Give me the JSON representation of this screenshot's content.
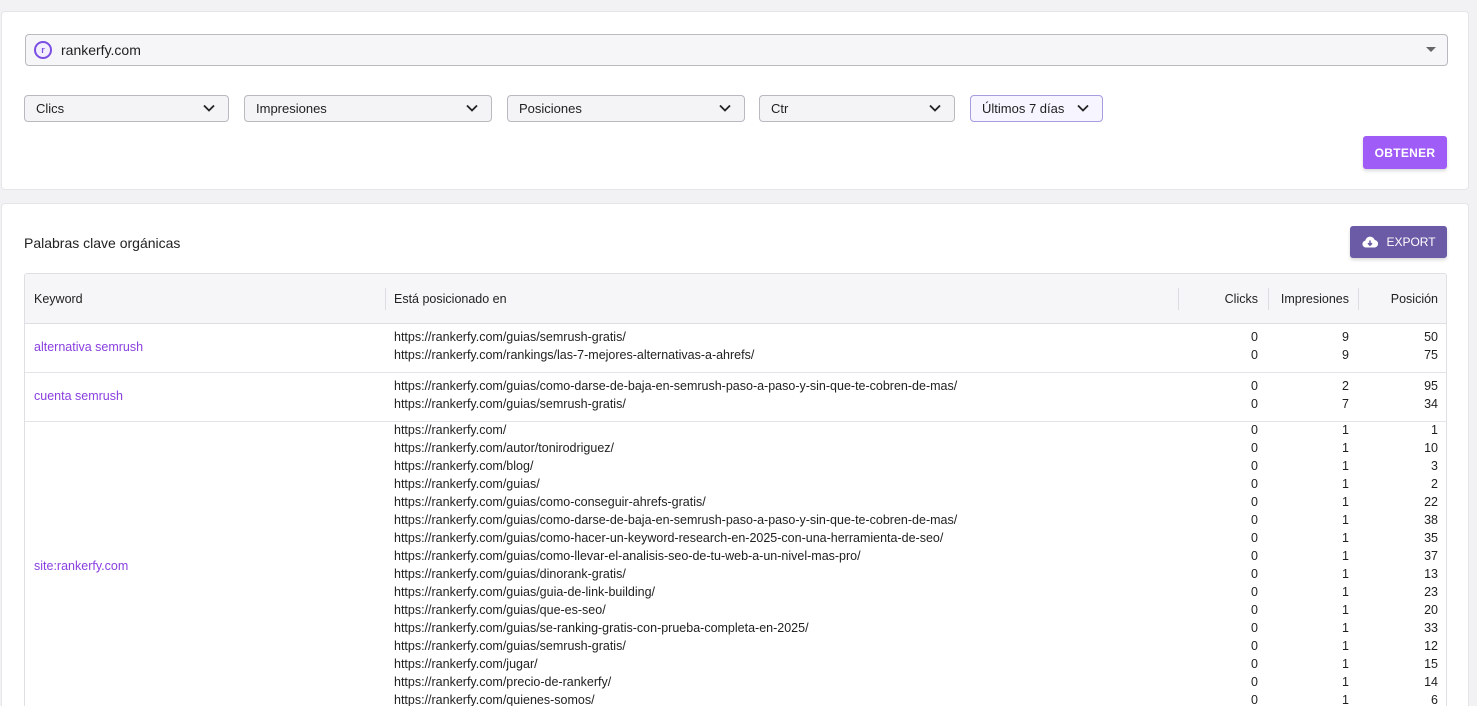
{
  "site": {
    "name": "rankerfy.com",
    "logo_text": "r"
  },
  "filters": [
    {
      "label": "Clics"
    },
    {
      "label": "Impresiones"
    },
    {
      "label": "Posiciones"
    },
    {
      "label": "Ctr"
    },
    {
      "label": "Últimos 7 días"
    }
  ],
  "obtener_label": "OBTENER",
  "section_title": "Palabras clave orgánicas",
  "export_label": "EXPORT",
  "table": {
    "headers": {
      "keyword": "Keyword",
      "url": "Está posicionado en",
      "clicks": "Clicks",
      "impresiones": "Impresiones",
      "posicion": "Posición"
    },
    "groups": [
      {
        "keyword": "alternativa semrush",
        "rows": [
          {
            "url": "https://rankerfy.com/guias/semrush-gratis/",
            "clicks": "0",
            "impresiones": "9",
            "posicion": "50"
          },
          {
            "url": "https://rankerfy.com/rankings/las-7-mejores-alternativas-a-ahrefs/",
            "clicks": "0",
            "impresiones": "9",
            "posicion": "75"
          }
        ]
      },
      {
        "keyword": "cuenta semrush",
        "rows": [
          {
            "url": "https://rankerfy.com/guias/como-darse-de-baja-en-semrush-paso-a-paso-y-sin-que-te-cobren-de-mas/",
            "clicks": "0",
            "impresiones": "2",
            "posicion": "95"
          },
          {
            "url": "https://rankerfy.com/guias/semrush-gratis/",
            "clicks": "0",
            "impresiones": "7",
            "posicion": "34"
          }
        ]
      },
      {
        "keyword": "site:rankerfy.com",
        "rows": [
          {
            "url": "https://rankerfy.com/",
            "clicks": "0",
            "impresiones": "1",
            "posicion": "1"
          },
          {
            "url": "https://rankerfy.com/autor/tonirodriguez/",
            "clicks": "0",
            "impresiones": "1",
            "posicion": "10"
          },
          {
            "url": "https://rankerfy.com/blog/",
            "clicks": "0",
            "impresiones": "1",
            "posicion": "3"
          },
          {
            "url": "https://rankerfy.com/guias/",
            "clicks": "0",
            "impresiones": "1",
            "posicion": "2"
          },
          {
            "url": "https://rankerfy.com/guias/como-conseguir-ahrefs-gratis/",
            "clicks": "0",
            "impresiones": "1",
            "posicion": "22"
          },
          {
            "url": "https://rankerfy.com/guias/como-darse-de-baja-en-semrush-paso-a-paso-y-sin-que-te-cobren-de-mas/",
            "clicks": "0",
            "impresiones": "1",
            "posicion": "38"
          },
          {
            "url": "https://rankerfy.com/guias/como-hacer-un-keyword-research-en-2025-con-una-herramienta-de-seo/",
            "clicks": "0",
            "impresiones": "1",
            "posicion": "35"
          },
          {
            "url": "https://rankerfy.com/guias/como-llevar-el-analisis-seo-de-tu-web-a-un-nivel-mas-pro/",
            "clicks": "0",
            "impresiones": "1",
            "posicion": "37"
          },
          {
            "url": "https://rankerfy.com/guias/dinorank-gratis/",
            "clicks": "0",
            "impresiones": "1",
            "posicion": "13"
          },
          {
            "url": "https://rankerfy.com/guias/guia-de-link-building/",
            "clicks": "0",
            "impresiones": "1",
            "posicion": "23"
          },
          {
            "url": "https://rankerfy.com/guias/que-es-seo/",
            "clicks": "0",
            "impresiones": "1",
            "posicion": "20"
          },
          {
            "url": "https://rankerfy.com/guias/se-ranking-gratis-con-prueba-completa-en-2025/",
            "clicks": "0",
            "impresiones": "1",
            "posicion": "33"
          },
          {
            "url": "https://rankerfy.com/guias/semrush-gratis/",
            "clicks": "0",
            "impresiones": "1",
            "posicion": "12"
          },
          {
            "url": "https://rankerfy.com/jugar/",
            "clicks": "0",
            "impresiones": "1",
            "posicion": "15"
          },
          {
            "url": "https://rankerfy.com/precio-de-rankerfy/",
            "clicks": "0",
            "impresiones": "1",
            "posicion": "14"
          },
          {
            "url": "https://rankerfy.com/quienes-somos/",
            "clicks": "0",
            "impresiones": "1",
            "posicion": "6"
          }
        ]
      }
    ]
  },
  "colors": {
    "accent": "#a05cf6",
    "export": "#6b5aa5",
    "keyword_link": "#8a3fe0"
  }
}
